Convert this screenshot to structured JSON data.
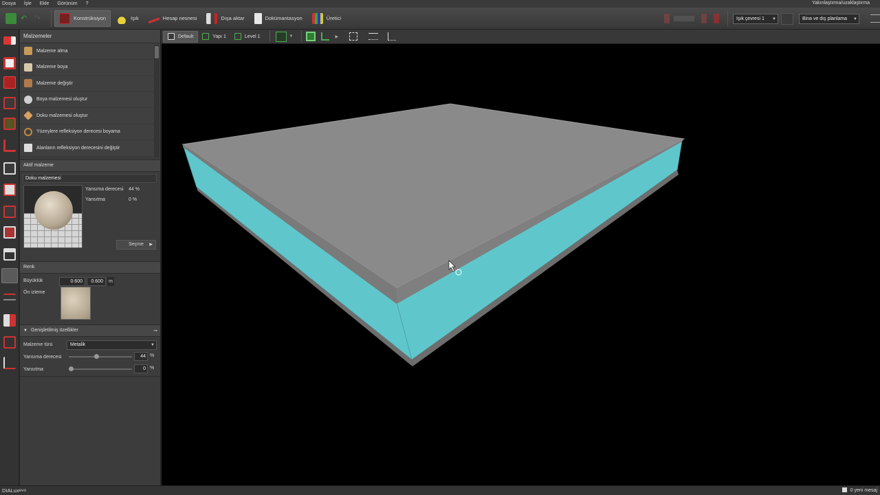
{
  "menu": {
    "items": [
      "Dosya",
      "İşle",
      "Ekle",
      "Görünüm",
      "?"
    ],
    "right": "Yakınlaştırma/uzaklaştırma"
  },
  "toolbar": {
    "tabs": [
      {
        "label": "Konstrüksiyon",
        "icon": "construction-icon"
      },
      {
        "label": "Işık",
        "icon": "light-icon"
      },
      {
        "label": "Hesap nesnesi",
        "icon": "calc-object-icon"
      },
      {
        "label": "Dışa aktar",
        "icon": "export-icon"
      },
      {
        "label": "Dokümantasyon",
        "icon": "documentation-icon"
      },
      {
        "label": "Üretici",
        "icon": "manufacturer-icon"
      }
    ],
    "light_scene": "Işık çevresi 1",
    "planning_mode": "Bina ve dış planlama"
  },
  "sidebar": {
    "materials_title": "Malzemeler",
    "material_tools": [
      {
        "label": "Malzeme alma",
        "icon": "eyedropper-icon",
        "color": "#c89a58"
      },
      {
        "label": "Malzeme boya",
        "icon": "paint-brush-icon",
        "color": "#d8c9a8"
      },
      {
        "label": "Malzeme değiştir",
        "icon": "replace-material-icon",
        "color": "#b07a4a"
      },
      {
        "label": "Boya malzemesi oluştur",
        "icon": "paint-material-icon",
        "color": "#cfcfcf"
      },
      {
        "label": "Doku malzemesi oluştur",
        "icon": "texture-material-icon",
        "color": "#d8a060"
      },
      {
        "label": "Yüzeylere refleksiyon derecesi boyama",
        "icon": "reflection-paint-icon",
        "color": "#c88a3a"
      },
      {
        "label": "Alanların refleksiyon derecesini değiştir",
        "icon": "reflection-change-icon",
        "color": "#dddddd"
      }
    ],
    "active_material": {
      "title": "Aktif malzeme",
      "name": "Doku malzemesi",
      "reflectance_label": "Yansıma derecesi",
      "reflectance_value": "44 %",
      "mirror_label": "Yansıtma",
      "mirror_value": "0 %",
      "select_button": "Seçme"
    },
    "color": {
      "title": "Renk",
      "size_label": "Büyüklük",
      "size_x": "0.600",
      "size_y": "0.600",
      "size_unit": "m",
      "preview_label": "Ön izleme"
    },
    "advanced": {
      "title": "Genişletilmiş özellikler",
      "type_label": "Malzeme türü",
      "type_value": "Metalik",
      "reflectance_label": "Yansıma derecesi",
      "reflectance_value": "44",
      "reflectance_fraction": 0.44,
      "mirror_label": "Yansıtma",
      "mirror_value": "0",
      "mirror_fraction": 0,
      "unit": "%"
    }
  },
  "viewport": {
    "tabs": [
      "Default",
      "Yapı 1",
      "Level 1"
    ],
    "colors": {
      "top": "#8a8a8a",
      "side_glass": "#5fc7cc",
      "rim": "#6d6d6d"
    }
  },
  "status": {
    "app_name_main": "DIALux",
    "app_name_suffix": "evo",
    "messages": "0 yeni mesaj"
  }
}
